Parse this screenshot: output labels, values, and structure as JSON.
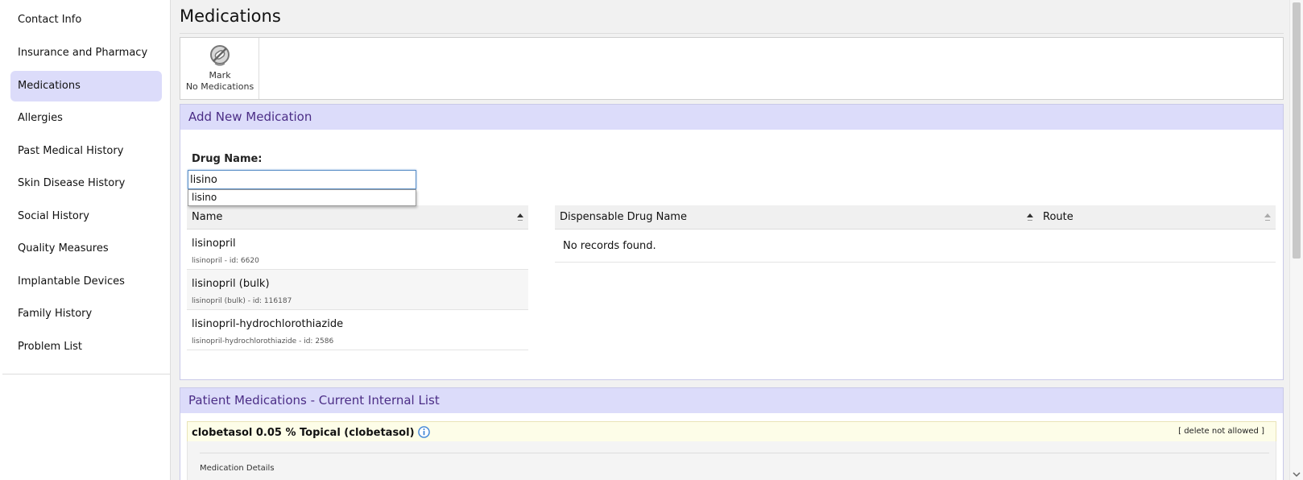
{
  "sidebar": {
    "items": [
      {
        "label": "Contact Info"
      },
      {
        "label": "Insurance and Pharmacy"
      },
      {
        "label": "Medications",
        "active": true
      },
      {
        "label": "Allergies"
      },
      {
        "label": "Past Medical History"
      },
      {
        "label": "Skin Disease History"
      },
      {
        "label": "Social History"
      },
      {
        "label": "Quality Measures"
      },
      {
        "label": "Implantable Devices"
      },
      {
        "label": "Family History"
      },
      {
        "label": "Problem List"
      }
    ]
  },
  "page": {
    "title": "Medications"
  },
  "toolbar": {
    "mark_no_meds": {
      "line1": "Mark",
      "line2": "No Medications",
      "icon": "no-medications-icon"
    }
  },
  "add_panel": {
    "title": "Add New Medication",
    "drug_name_label": "Drug Name:",
    "drug_name_value": "lisino",
    "autocomplete": [
      "lisino"
    ],
    "name_table": {
      "header": "Name",
      "rows": [
        {
          "name": "lisinopril",
          "sub_name": "lisinopril",
          "sub_sep": "-",
          "sub_id": "id: 6620"
        },
        {
          "name": "lisinopril (bulk)",
          "sub_name": "lisinopril (bulk)",
          "sub_sep": "-",
          "sub_id": "id: 116187"
        },
        {
          "name": "lisinopril-hydrochlorothiazide",
          "sub_name": "lisinopril-hydrochlorothiazide",
          "sub_sep": "-",
          "sub_id": "id: 2586"
        }
      ]
    },
    "dispensable_table": {
      "headers": [
        "Dispensable Drug Name",
        "Route"
      ],
      "empty_text": "No records found."
    }
  },
  "patient_panel": {
    "title": "Patient Medications - Current Internal List",
    "medication": {
      "name": "clobetasol 0.05 % Topical (clobetasol)",
      "action": "[ delete not allowed ]",
      "details_label": "Medication Details"
    }
  },
  "colors": {
    "accent": "#dcdcfa",
    "panel_title": "#4b2d86",
    "highlight_row": "#fdfde8",
    "info": "#3b82d6"
  }
}
